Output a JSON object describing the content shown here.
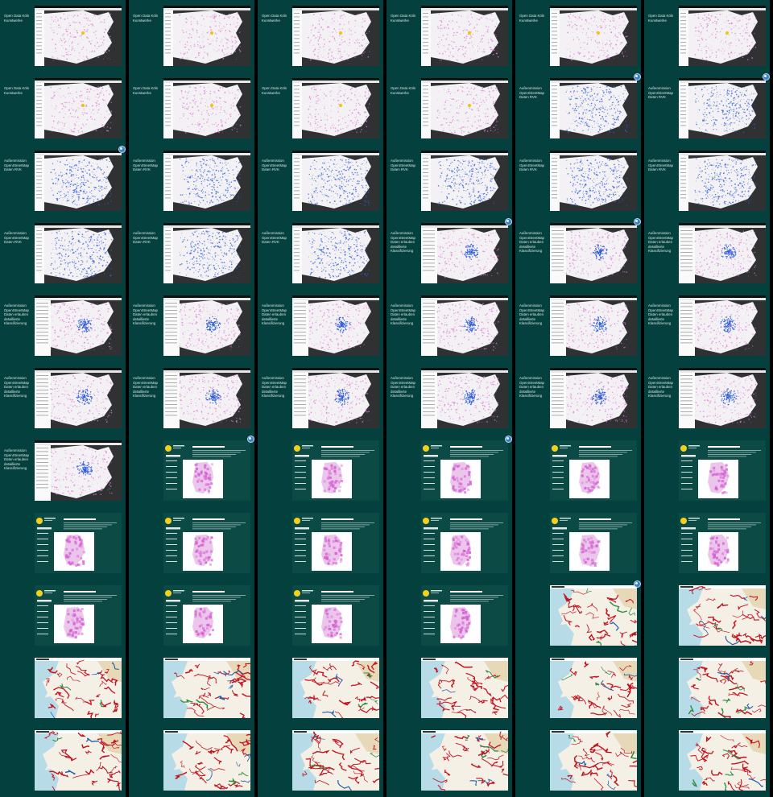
{
  "contact_sheet": {
    "columns": 6,
    "rows": 11,
    "frames": [
      {
        "kind": "open",
        "label": "Open Data Köln Kunstwerke"
      },
      {
        "kind": "open",
        "label": "Open Data Köln Kunstwerke"
      },
      {
        "kind": "open",
        "label": "Open Data Köln Kunstwerke"
      },
      {
        "kind": "open",
        "label": "Open Data Köln Kunstwerke"
      },
      {
        "kind": "open",
        "label": "Open Data Köln Kunstwerke"
      },
      {
        "kind": "open",
        "label": "Open Data Köln Kunstwerke"
      },
      {
        "kind": "open",
        "label": "Open Data Köln Kunstwerke"
      },
      {
        "kind": "open",
        "label": "Open Data Köln Kunstwerke"
      },
      {
        "kind": "open",
        "label": "Open Data Köln Kunstwerke"
      },
      {
        "kind": "open",
        "label": "Open Data Köln Kunstwerke"
      },
      {
        "kind": "osm",
        "label": "Außenmission OpenStreetMap Daten RVK",
        "badge": true
      },
      {
        "kind": "osm",
        "label": "Außenmission OpenStreetMap Daten RVK",
        "badge": true
      },
      {
        "kind": "osm",
        "label": "Außenmission OpenStreetMap Daten RVK",
        "badge": true
      },
      {
        "kind": "osm",
        "label": "Außenmission OpenStreetMap Daten RVK"
      },
      {
        "kind": "osm",
        "label": "Außenmission OpenStreetMap Daten RVK"
      },
      {
        "kind": "osm",
        "label": "Außenmission OpenStreetMap Daten RVK"
      },
      {
        "kind": "osm",
        "label": "Außenmission OpenStreetMap Daten RVK"
      },
      {
        "kind": "osm",
        "label": "Außenmission OpenStreetMap Daten RVK"
      },
      {
        "kind": "osm",
        "label": "Außenmission OpenStreetMap Daten RVK"
      },
      {
        "kind": "osm",
        "label": "Außenmission OpenStreetMap Daten RVK"
      },
      {
        "kind": "osm",
        "label": "Außenmission OpenStreetMap Daten RVK"
      },
      {
        "kind": "mix",
        "label": "Außenmission OpenStreetMap Daten erlauben detaillierte Klassifizierung",
        "badge": true
      },
      {
        "kind": "mix",
        "label": "Außenmission OpenStreetMap Daten erlauben detaillierte Klassifizierung",
        "badge": true
      },
      {
        "kind": "mix",
        "label": "Außenmission OpenStreetMap Daten erlauben detaillierte Klassifizierung"
      },
      {
        "kind": "mix",
        "label": "Außenmission OpenStreetMap Daten erlauben detaillierte Klassifizierung"
      },
      {
        "kind": "mix",
        "label": "Außenmission OpenStreetMap Daten erlauben detaillierte Klassifizierung"
      },
      {
        "kind": "mix",
        "label": "Außenmission OpenStreetMap Daten erlauben detaillierte Klassifizierung"
      },
      {
        "kind": "mix",
        "label": "Außenmission OpenStreetMap Daten erlauben detaillierte Klassifizierung"
      },
      {
        "kind": "mix",
        "label": "Außenmission OpenStreetMap Daten erlauben detaillierte Klassifizierung"
      },
      {
        "kind": "mix",
        "label": "Außenmission OpenStreetMap Daten erlauben detaillierte Klassifizierung"
      },
      {
        "kind": "mix",
        "label": "Außenmission OpenStreetMap Daten erlauben detaillierte Klassifizierung"
      },
      {
        "kind": "mix",
        "label": "Außenmission OpenStreetMap Daten erlauben detaillierte Klassifizierung"
      },
      {
        "kind": "mix",
        "label": "Außenmission OpenStreetMap Daten erlauben detaillierte Klassifizierung"
      },
      {
        "kind": "mix",
        "label": "Außenmission OpenStreetMap Daten erlauben detaillierte Klassifizierung"
      },
      {
        "kind": "mix",
        "label": "Außenmission OpenStreetMap Daten erlauben detaillierte Klassifizierung"
      },
      {
        "kind": "mix",
        "label": "Außenmission OpenStreetMap Daten erlauben detaillierte Klassifizierung"
      },
      {
        "kind": "mix",
        "label": "Außenmission OpenStreetMap Daten erlauben detaillierte Klassifizierung"
      },
      {
        "kind": "de",
        "label": "",
        "badge": true
      },
      {
        "kind": "de",
        "label": ""
      },
      {
        "kind": "de",
        "label": "",
        "badge": true
      },
      {
        "kind": "de",
        "label": ""
      },
      {
        "kind": "de",
        "label": ""
      },
      {
        "kind": "de",
        "label": ""
      },
      {
        "kind": "de",
        "label": ""
      },
      {
        "kind": "de",
        "label": ""
      },
      {
        "kind": "de",
        "label": ""
      },
      {
        "kind": "de",
        "label": ""
      },
      {
        "kind": "de",
        "label": ""
      },
      {
        "kind": "de",
        "label": ""
      },
      {
        "kind": "de",
        "label": ""
      },
      {
        "kind": "de",
        "label": ""
      },
      {
        "kind": "de",
        "label": ""
      },
      {
        "kind": "river",
        "label": "",
        "badge": true
      },
      {
        "kind": "river",
        "label": ""
      },
      {
        "kind": "river",
        "label": ""
      },
      {
        "kind": "river",
        "label": ""
      },
      {
        "kind": "river",
        "label": ""
      },
      {
        "kind": "river",
        "label": ""
      },
      {
        "kind": "river",
        "label": ""
      },
      {
        "kind": "river",
        "label": ""
      },
      {
        "kind": "river",
        "label": ""
      },
      {
        "kind": "river",
        "label": ""
      },
      {
        "kind": "river",
        "label": ""
      },
      {
        "kind": "river",
        "label": ""
      },
      {
        "kind": "river",
        "label": ""
      },
      {
        "kind": "river",
        "label": ""
      }
    ],
    "colors": {
      "column_bg": "#04403d",
      "gutter": "#000000",
      "map_dark": "#2f3132",
      "map_land": "#f3f1f4",
      "pink": "#e07ad8",
      "blue": "#2f5fd8",
      "slide_teal": "#0b4a45",
      "sea": "#b8dbe8",
      "river_red": "#c1121f"
    }
  }
}
